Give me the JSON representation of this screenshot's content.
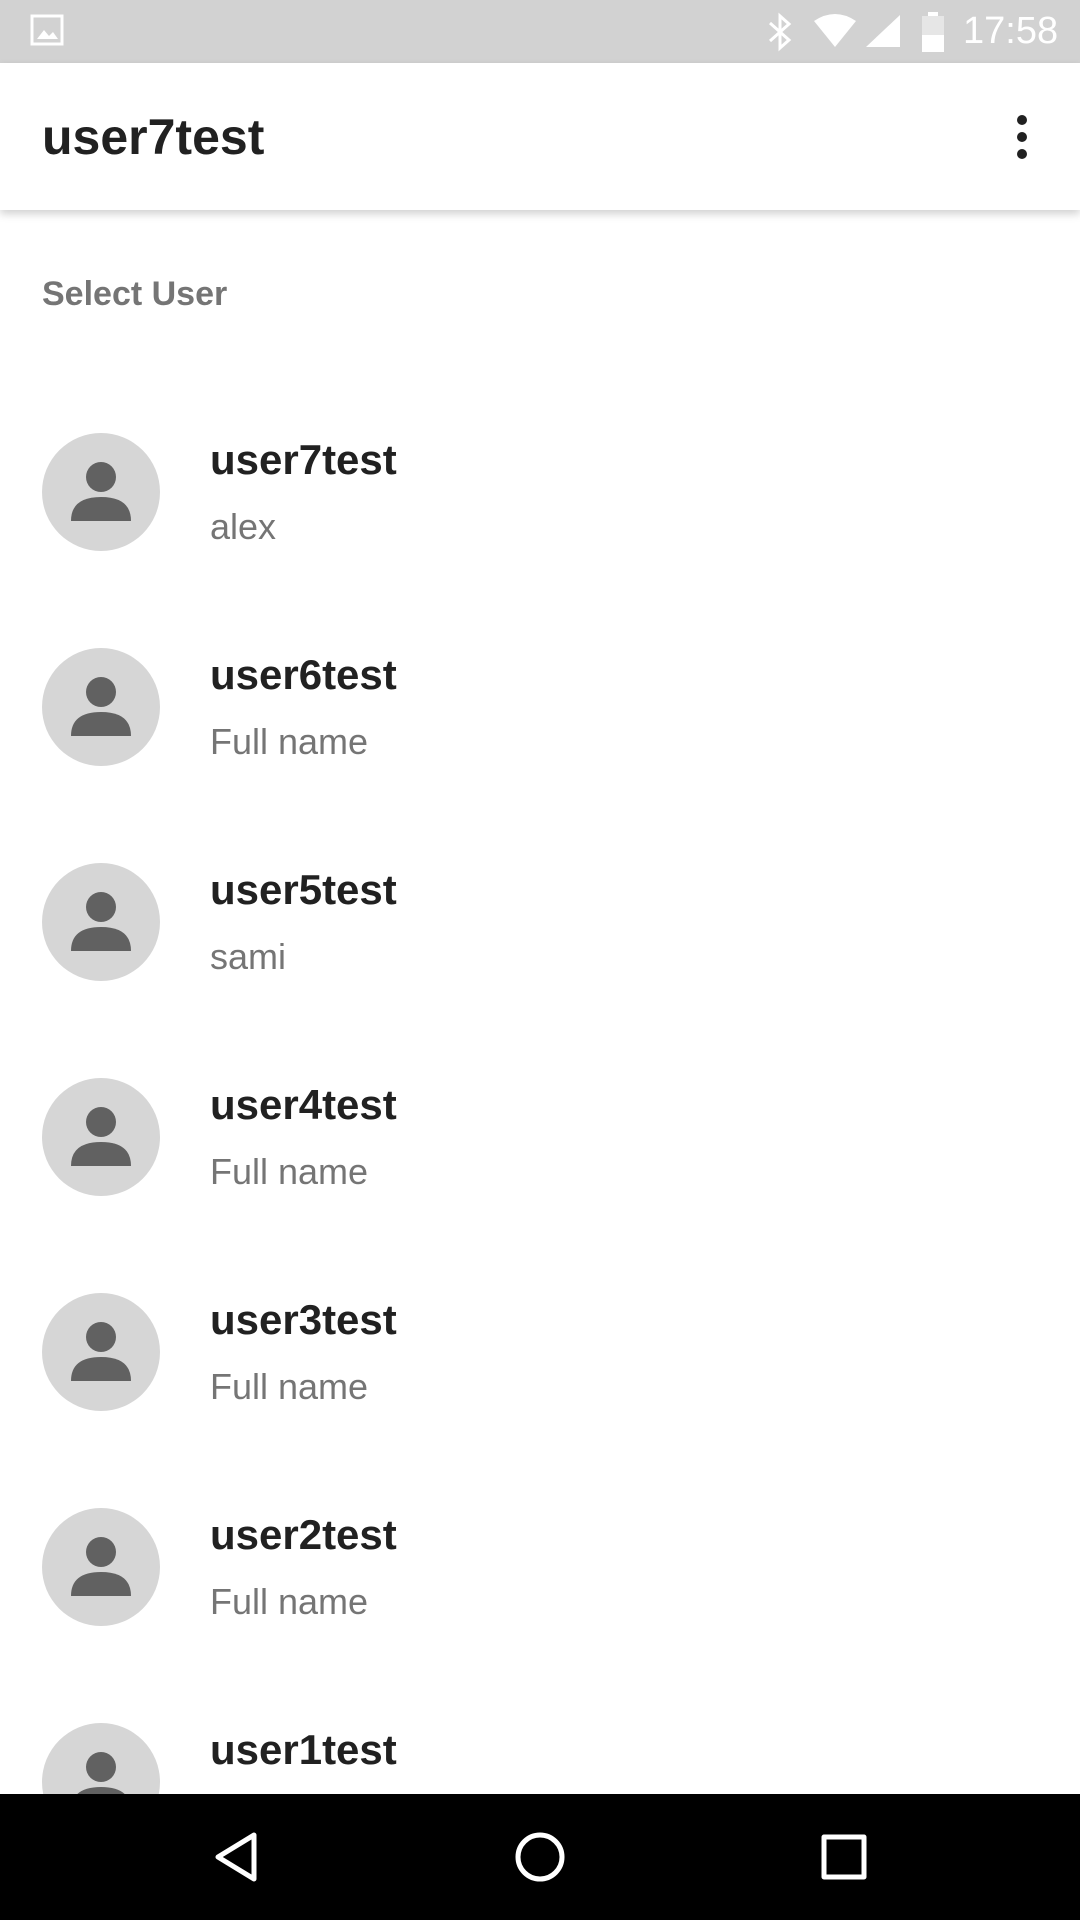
{
  "status_bar": {
    "time": "17:58",
    "icons": [
      "gallery-icon",
      "bluetooth-icon",
      "wifi-icon",
      "signal-icon",
      "battery-icon"
    ]
  },
  "app_bar": {
    "title": "user7test",
    "menu_icon": "more-vert-icon"
  },
  "section": {
    "label": "Select User"
  },
  "users": [
    {
      "username": "user7test",
      "full_name": "alex"
    },
    {
      "username": "user6test",
      "full_name": "Full name"
    },
    {
      "username": "user5test",
      "full_name": "sami"
    },
    {
      "username": "user4test",
      "full_name": "Full name"
    },
    {
      "username": "user3test",
      "full_name": "Full name"
    },
    {
      "username": "user2test",
      "full_name": "Full name"
    },
    {
      "username": "user1test",
      "full_name": ""
    }
  ],
  "nav_bar": {
    "icons": [
      "back-icon",
      "home-icon",
      "recents-icon"
    ]
  },
  "colors": {
    "status_bar": "#d2d2d2",
    "avatar_bg": "#d6d6d6",
    "avatar_fg": "#616161",
    "primary_text": "#212121",
    "secondary_text": "#757575"
  }
}
